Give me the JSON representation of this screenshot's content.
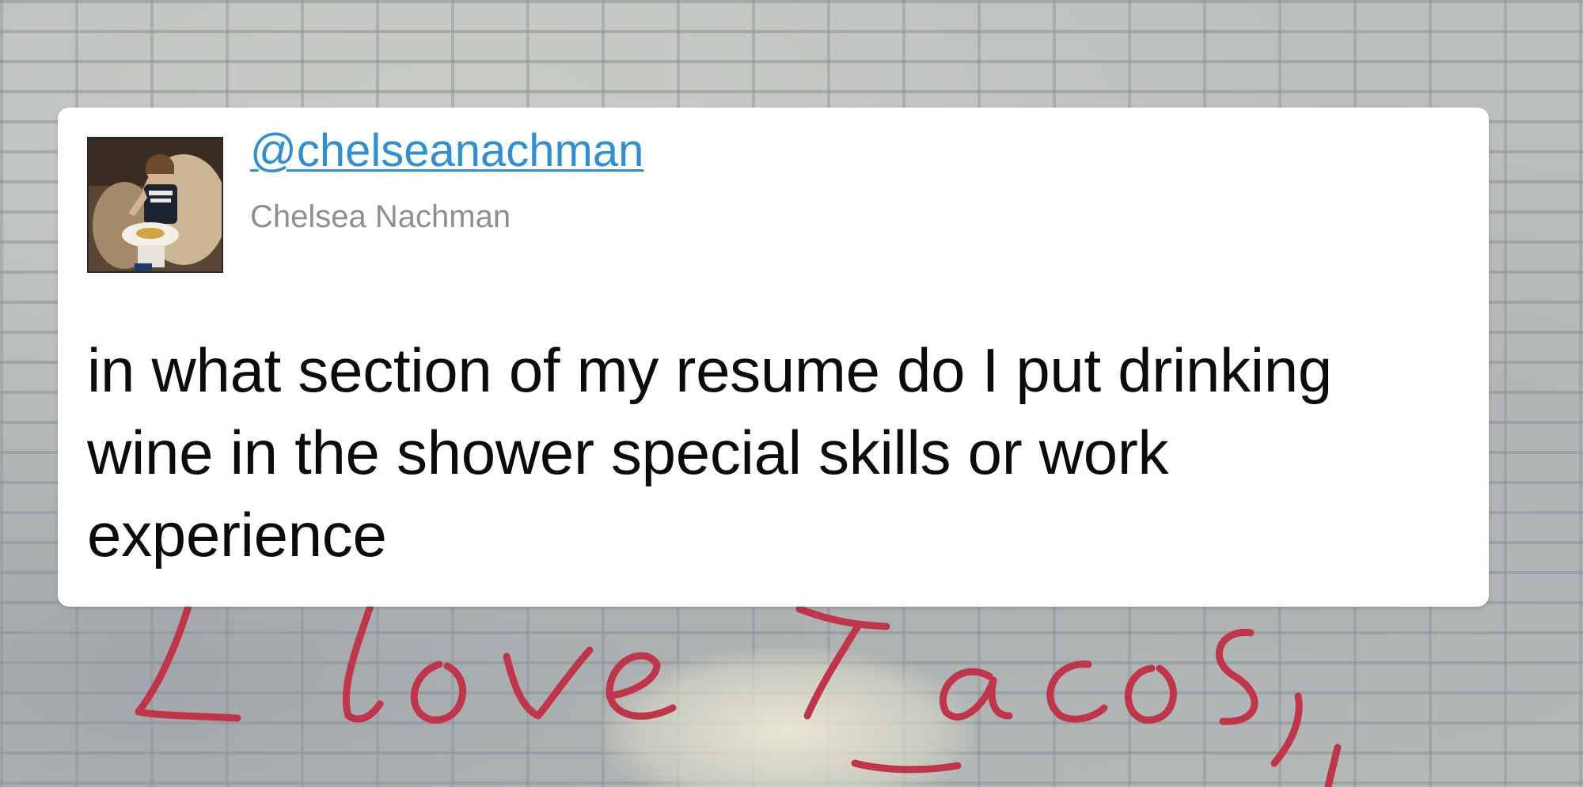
{
  "tweet": {
    "handle": "@chelseanachman",
    "display_name": "Chelsea Nachman",
    "text": "in what section of my resume do I put drinking wine in the shower special skills or work experience",
    "avatar_icon": "user-photo-avatar"
  },
  "background": {
    "graffiti_text": "I love tacos,",
    "graffiti_color": "#c0354a",
    "wall_color": "#bcc0bd"
  },
  "colors": {
    "link": "#2f8fd3",
    "secondary_text": "#8f8f8f",
    "card_bg": "#ffffff"
  }
}
